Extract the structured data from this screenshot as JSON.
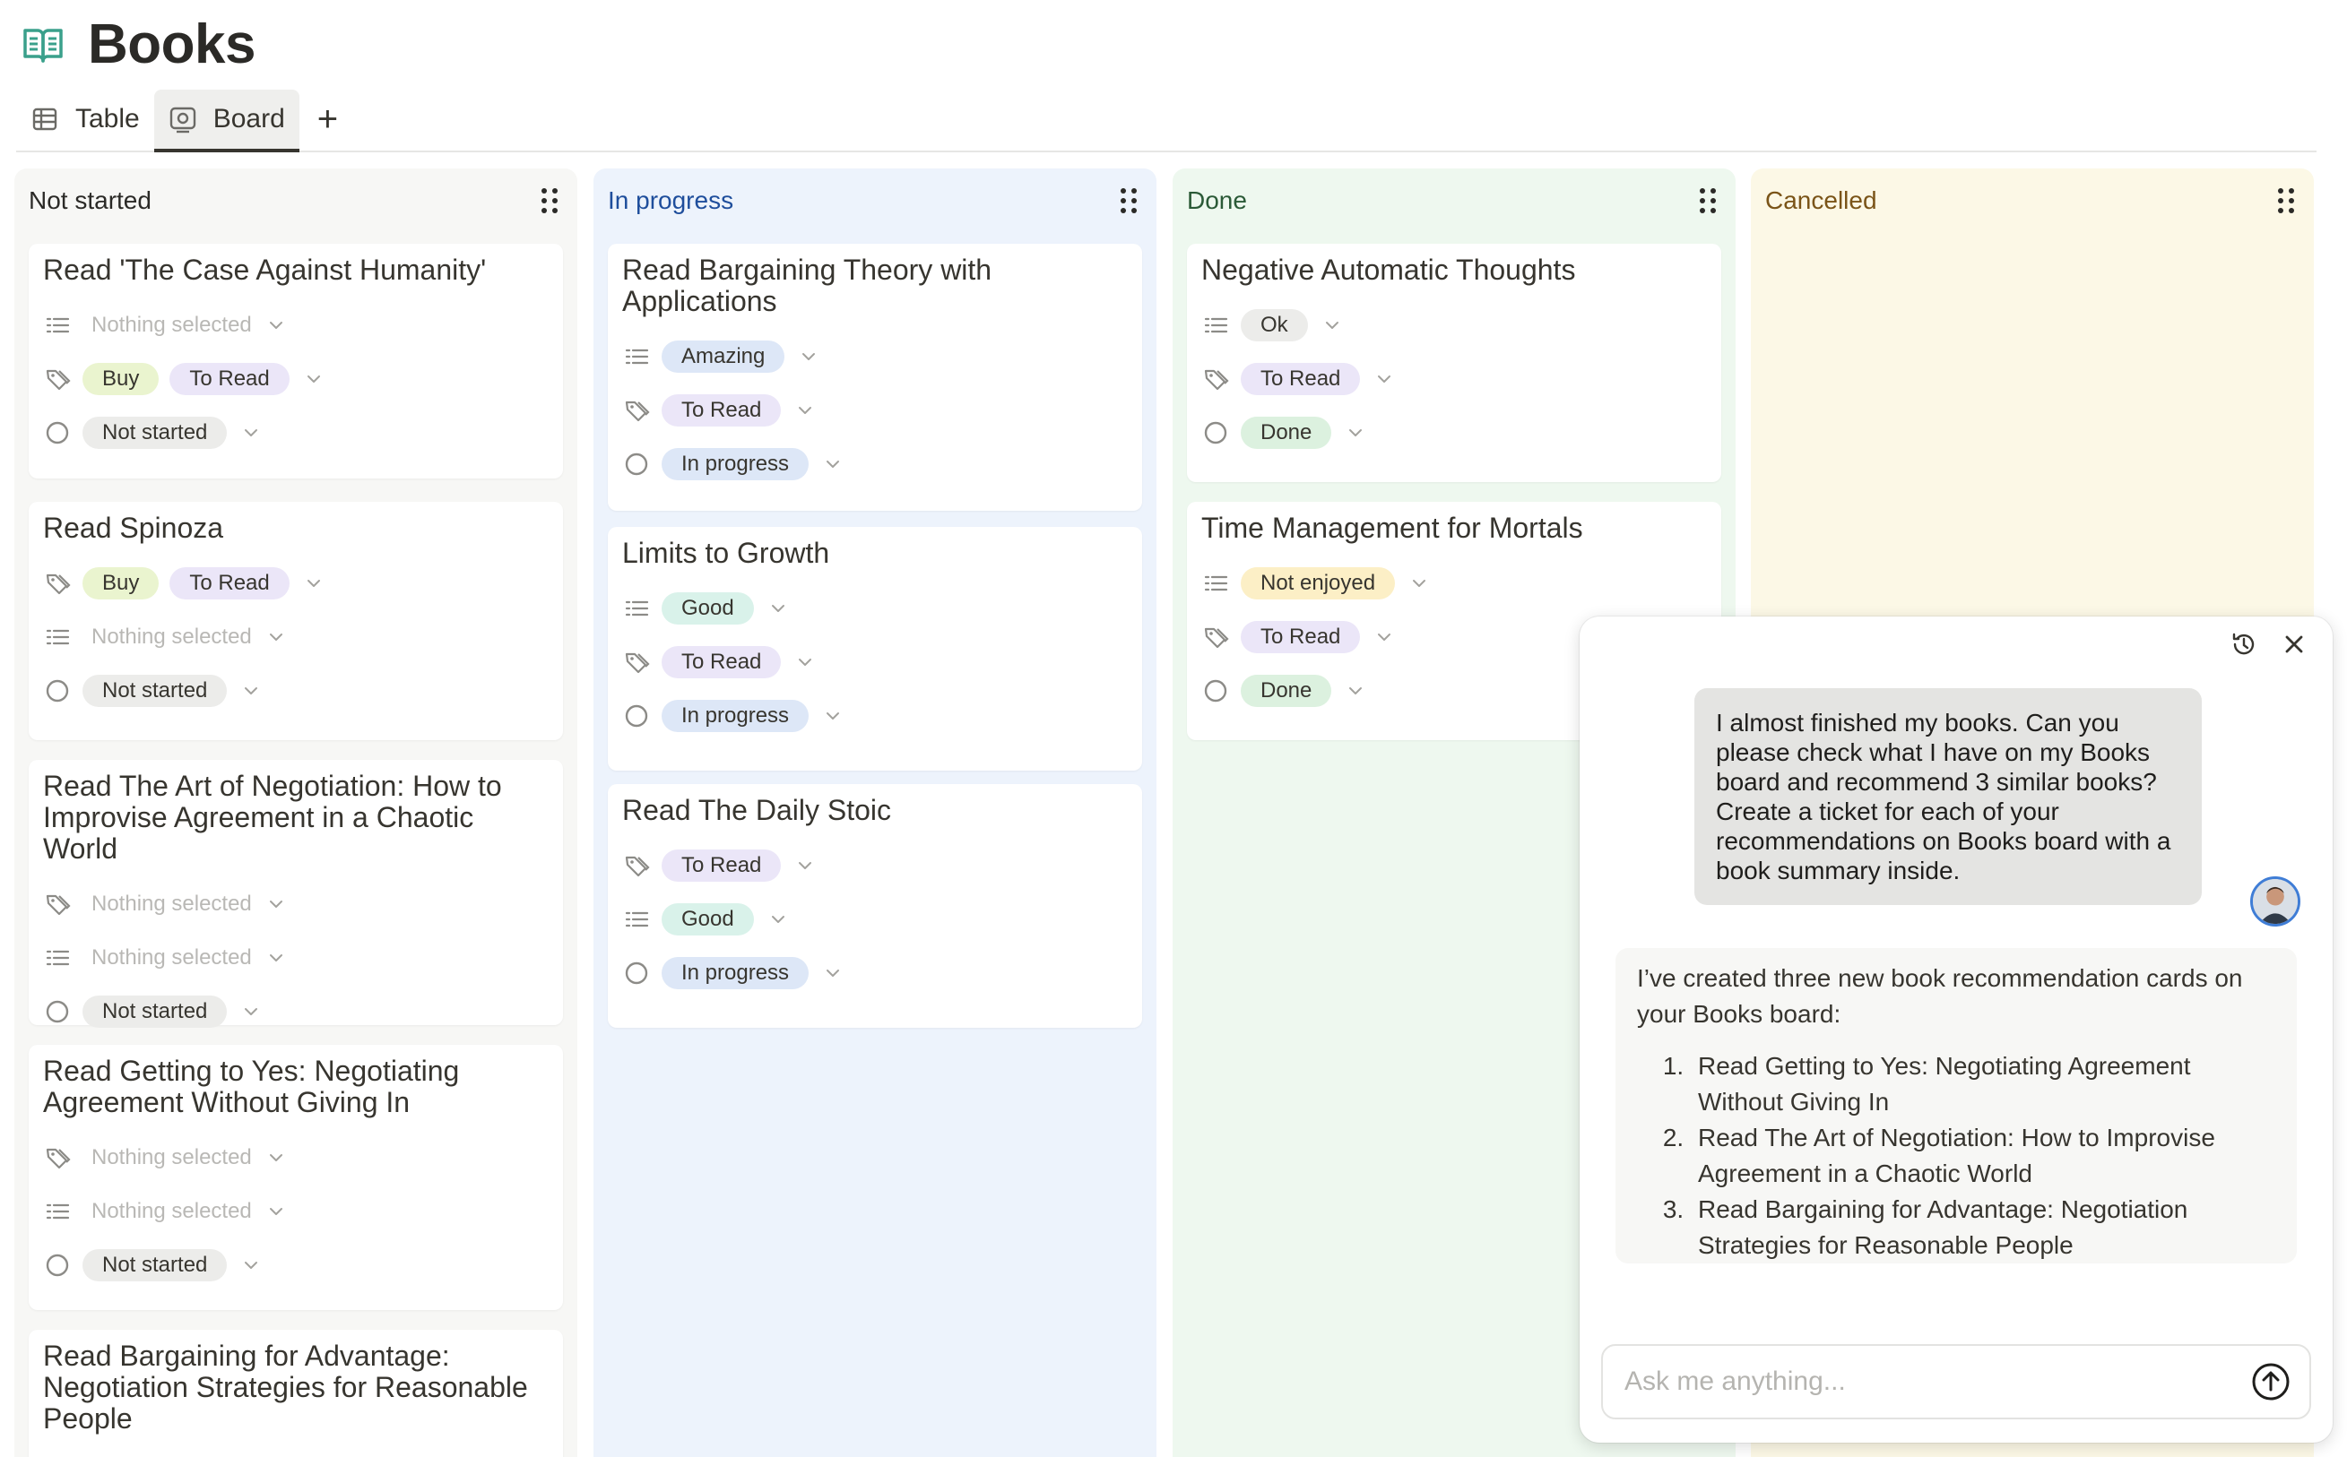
{
  "page": {
    "title": "Books"
  },
  "tabs": [
    {
      "label": "Table",
      "icon": "table-icon",
      "active": false
    },
    {
      "label": "Board",
      "icon": "board-icon",
      "active": true
    }
  ],
  "tab_add_label": "+",
  "colors": {
    "not_started_col": "#f7f7f5",
    "in_progress_col": "#edf3fc",
    "done_col": "#eef8ef",
    "cancelled_col": "#fcf8e6",
    "pill_gray": "#ececea",
    "pill_purple": "#ebe6f8",
    "pill_green_lime": "#eaf4cf",
    "pill_teal": "#d9f2ea",
    "pill_blue": "#dde7f7",
    "pill_done": "#dcf1df",
    "pill_yellow": "#fcefc6"
  },
  "columns": [
    {
      "name": "Not started",
      "cards": [
        {
          "title": "Read 'The Case Against Humanity'",
          "props": [
            {
              "icon": "list-icon",
              "empty": "Nothing selected"
            },
            {
              "icon": "tag-icon",
              "pills": [
                "Buy",
                "To Read"
              ]
            },
            {
              "icon": "status-circle-icon",
              "pills": [
                "Not started"
              ]
            }
          ]
        },
        {
          "title": "Read Spinoza",
          "props": [
            {
              "icon": "tag-icon",
              "pills": [
                "Buy",
                "To Read"
              ]
            },
            {
              "icon": "list-icon",
              "empty": "Nothing selected"
            },
            {
              "icon": "status-circle-icon",
              "pills": [
                "Not started"
              ]
            }
          ]
        },
        {
          "title": "Read The Art of Negotiation: How to Improvise Agreement in a Chaotic World",
          "props": [
            {
              "icon": "tag-icon",
              "empty": "Nothing selected"
            },
            {
              "icon": "list-icon",
              "empty": "Nothing selected"
            },
            {
              "icon": "status-circle-icon",
              "pills": [
                "Not started"
              ]
            }
          ]
        },
        {
          "title": "Read Getting to Yes: Negotiating Agreement Without Giving In",
          "props": [
            {
              "icon": "tag-icon",
              "empty": "Nothing selected"
            },
            {
              "icon": "list-icon",
              "empty": "Nothing selected"
            },
            {
              "icon": "status-circle-icon",
              "pills": [
                "Not started"
              ]
            }
          ]
        },
        {
          "title": "Read Bargaining for Advantage: Negotiation Strategies for Reasonable People",
          "props": []
        }
      ]
    },
    {
      "name": "In progress",
      "cards": [
        {
          "title": "Read Bargaining Theory with Applications",
          "props": [
            {
              "icon": "list-icon",
              "pills": [
                "Amazing"
              ]
            },
            {
              "icon": "tag-icon",
              "pills": [
                "To Read"
              ]
            },
            {
              "icon": "status-circle-icon",
              "pills": [
                "In progress"
              ]
            }
          ]
        },
        {
          "title": "Limits to Growth",
          "props": [
            {
              "icon": "list-icon",
              "pills": [
                "Good"
              ]
            },
            {
              "icon": "tag-icon",
              "pills": [
                "To Read"
              ]
            },
            {
              "icon": "status-circle-icon",
              "pills": [
                "In progress"
              ]
            }
          ]
        },
        {
          "title": "Read The Daily Stoic",
          "props": [
            {
              "icon": "tag-icon",
              "pills": [
                "To Read"
              ]
            },
            {
              "icon": "list-icon",
              "pills": [
                "Good"
              ]
            },
            {
              "icon": "status-circle-icon",
              "pills": [
                "In progress"
              ]
            }
          ]
        }
      ]
    },
    {
      "name": "Done",
      "cards": [
        {
          "title": "Negative Automatic Thoughts",
          "props": [
            {
              "icon": "list-icon",
              "pills": [
                "Ok"
              ]
            },
            {
              "icon": "tag-icon",
              "pills": [
                "To Read"
              ]
            },
            {
              "icon": "status-circle-icon",
              "pills": [
                "Done"
              ]
            }
          ]
        },
        {
          "title": "Time Management for Mortals",
          "props": [
            {
              "icon": "list-icon",
              "pills": [
                "Not enjoyed"
              ]
            },
            {
              "icon": "tag-icon",
              "pills": [
                "To Read"
              ]
            },
            {
              "icon": "status-circle-icon",
              "pills": [
                "Done"
              ]
            }
          ]
        }
      ]
    },
    {
      "name": "Cancelled",
      "cards": []
    }
  ],
  "chat": {
    "user_message": "I almost finished my books. Can you please check what I have on my Books board and recommend 3 similar books? Create a ticket for each of your recommendations on Books board with a book summary inside.",
    "ai_intro": "I’ve created three new book recommendation cards on your Books board:",
    "ai_list": [
      "Read Getting to Yes: Negotiating Agreement Without Giving In",
      "Read The Art of Negotiation: How to Improvise Agreement in a Chaotic World",
      "Read Bargaining for Advantage: Negotiation Strategies for Reasonable People"
    ],
    "input_placeholder": "Ask me anything..."
  }
}
